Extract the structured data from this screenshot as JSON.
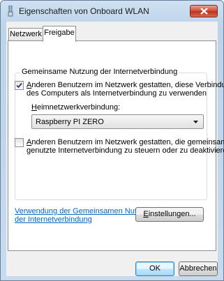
{
  "window": {
    "title": "Eigenschaften von Onboard WLAN"
  },
  "tabs": [
    {
      "label": "Netzwerk"
    },
    {
      "label": "Freigabe"
    }
  ],
  "group": {
    "label": "Gemeinsame Nutzung der Internetverbindung",
    "allow_sharing": {
      "checked": true,
      "line1_accel": "A",
      "line1_rest": "nderen Benutzern im Netzwerk gestatten, diese Verbindung",
      "line2": "des Computers als Internetverbindung zu verwenden"
    },
    "home_network": {
      "label_accel": "H",
      "label_rest": "eimnetzwerkverbindung:",
      "value": "Raspberry PI ZERO"
    },
    "allow_control": {
      "checked": false,
      "line1_accel": "A",
      "line1_rest": "nderen Benutzern im Netzwerk gestatten, die gemeinsam",
      "line2": "genutzte Internetverbindung zu steuern oder zu deaktivieren"
    }
  },
  "help_link": {
    "line1": "Verwendung der Gemeinsamen Nutzung",
    "line2": "der Internetverbindung"
  },
  "buttons": {
    "settings_accel": "E",
    "settings_rest": "instellungen...",
    "ok": "OK",
    "cancel": "Abbrechen"
  }
}
